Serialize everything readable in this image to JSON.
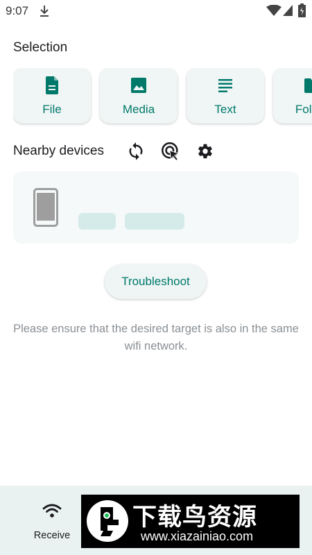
{
  "status_bar": {
    "time": "9:07"
  },
  "selection": {
    "title": "Selection",
    "cards": [
      {
        "label": "File",
        "icon": "file-icon"
      },
      {
        "label": "Media",
        "icon": "image-icon"
      },
      {
        "label": "Text",
        "icon": "text-lines-icon"
      },
      {
        "label": "Folder",
        "icon": "folder-icon"
      }
    ]
  },
  "nearby": {
    "title": "Nearby devices",
    "actions": [
      "refresh-icon",
      "scan-target-icon",
      "gear-icon"
    ]
  },
  "troubleshoot": {
    "label": "Troubleshoot"
  },
  "hint": "Please ensure that the desired target is also in the same wifi network.",
  "bottom_nav": {
    "receive_label": "Receive"
  },
  "watermark": {
    "title": "下载鸟资源",
    "url": "www.xiazainiao.com"
  },
  "colors": {
    "accent": "#00796b",
    "card_bg": "#f0f6f5",
    "nav_bg": "#e9f2f1",
    "placeholder": "#d5ebea"
  }
}
